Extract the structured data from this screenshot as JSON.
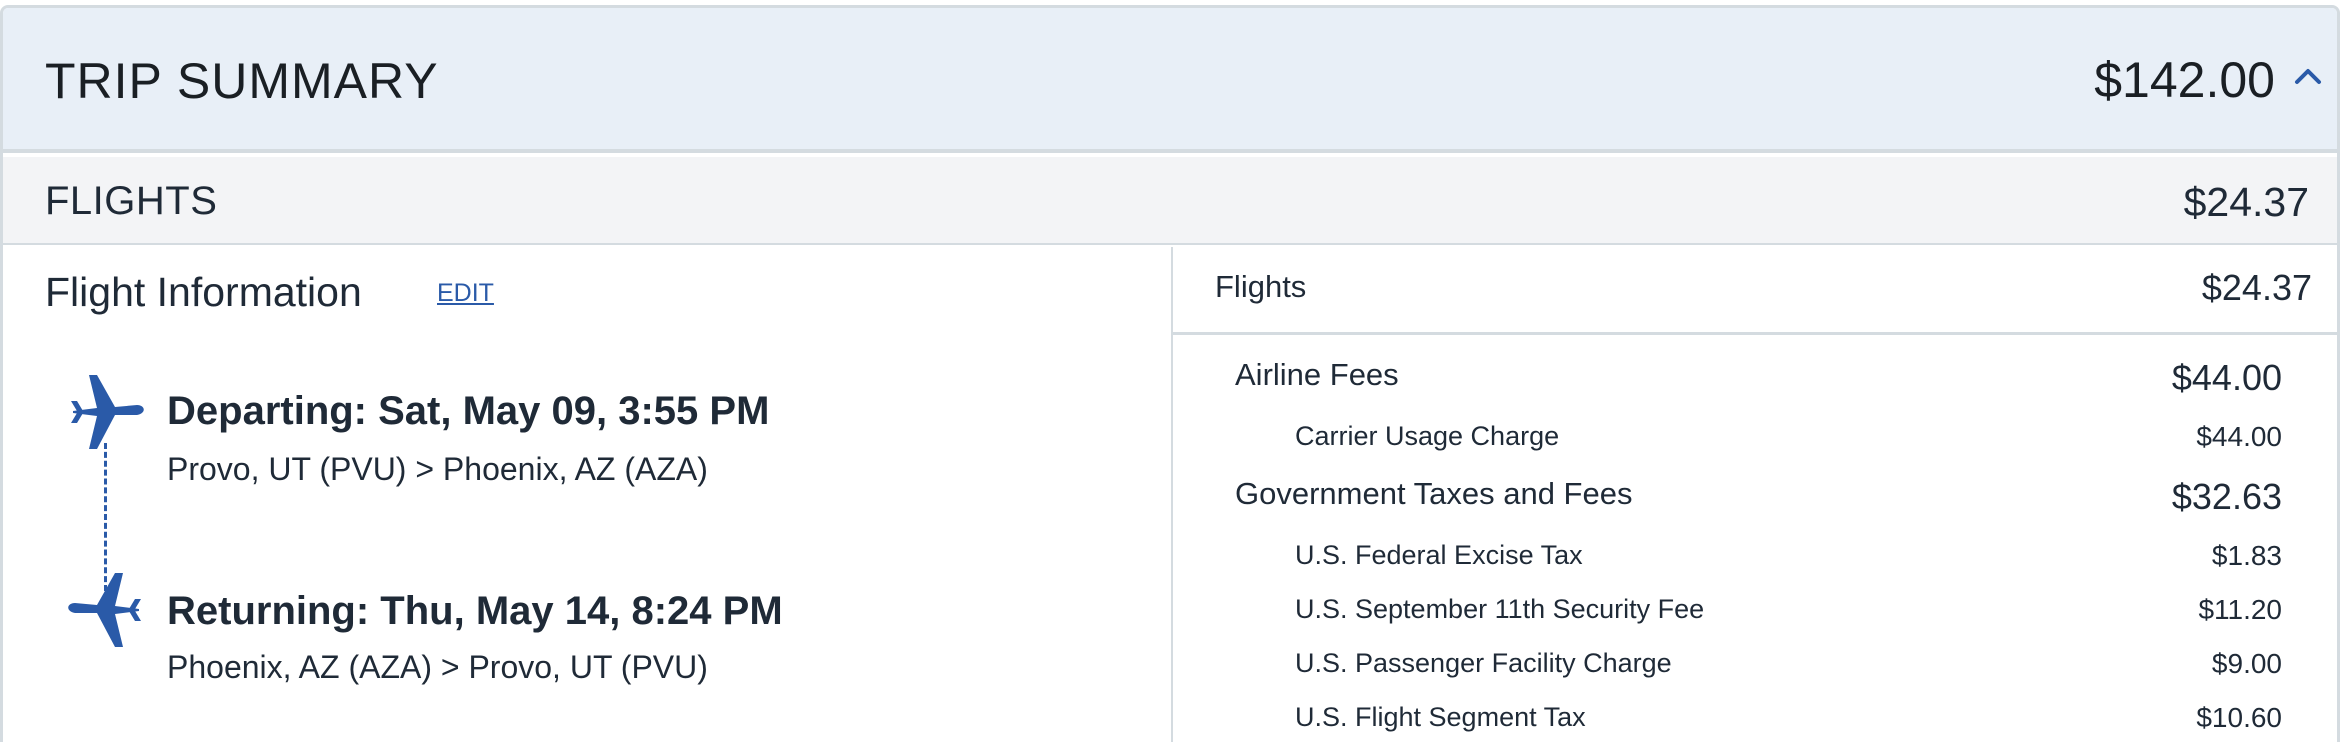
{
  "trip_summary": {
    "title": "TRIP SUMMARY",
    "total": "$142.00",
    "toggle_icon": "chevron-up-icon"
  },
  "flights_section": {
    "title": "FLIGHTS",
    "total": "$24.37"
  },
  "flight_information": {
    "heading": "Flight Information",
    "edit_label": "EDIT",
    "departing": {
      "title": "Departing: Sat, May 09, 3:55 PM",
      "route": "Provo, UT (PVU) > Phoenix, AZ (AZA)",
      "icon": "plane-depart-icon"
    },
    "returning": {
      "title": "Returning: Thu, May 14, 8:24 PM",
      "route": "Phoenix, AZ (AZA) > Provo, UT (PVU)",
      "icon": "plane-return-icon"
    }
  },
  "price_breakdown": {
    "flights_label": "Flights",
    "flights_amount": "$24.37",
    "airline_fees": {
      "label": "Airline Fees",
      "amount": "$44.00",
      "items": [
        {
          "label": "Carrier Usage Charge",
          "amount": "$44.00"
        }
      ]
    },
    "government_taxes": {
      "label": "Government Taxes and Fees",
      "amount": "$32.63",
      "items": [
        {
          "label": "U.S. Federal Excise Tax",
          "amount": "$1.83"
        },
        {
          "label": "U.S. September 11th Security Fee",
          "amount": "$11.20"
        },
        {
          "label": "U.S. Passenger Facility Charge",
          "amount": "$9.00"
        },
        {
          "label": "U.S. Flight Segment Tax",
          "amount": "$10.60"
        }
      ]
    }
  },
  "colors": {
    "accent": "#2a5aa8",
    "header_bg": "#e8eff7",
    "band_bg": "#f3f4f6",
    "border": "#d4dbe0"
  }
}
